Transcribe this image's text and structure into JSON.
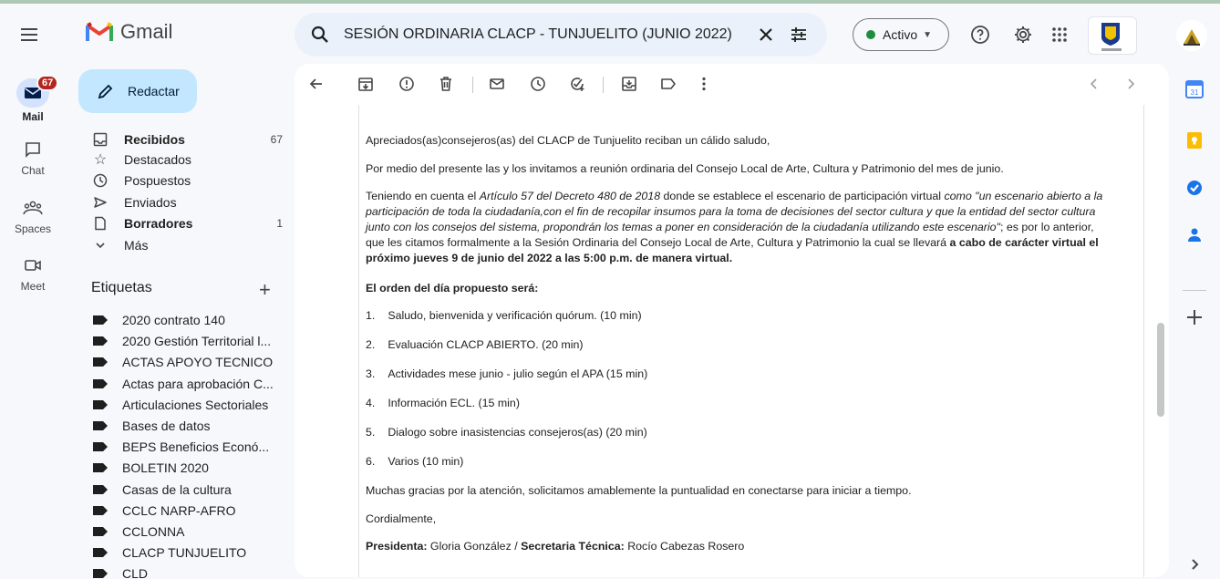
{
  "app": {
    "name": "Gmail"
  },
  "search": {
    "query": "SESIÓN ORDINARIA CLACP - TUNJUELITO (JUNIO 2022)"
  },
  "header": {
    "status_label": "Activo",
    "status_color": "#1e8e3e",
    "icons": [
      "menu-icon",
      "search-icon",
      "close-icon",
      "filter-icon",
      "help-icon",
      "settings-icon",
      "apps-icon"
    ]
  },
  "rail": {
    "mail": {
      "label": "Mail",
      "badge": "67"
    },
    "chat": {
      "label": "Chat"
    },
    "spaces": {
      "label": "Spaces"
    },
    "meet": {
      "label": "Meet"
    }
  },
  "compose": {
    "label": "Redactar"
  },
  "folders": [
    {
      "label": "Recibidos",
      "count": "67",
      "icon": "inbox-icon",
      "bold": true
    },
    {
      "label": "Destacados",
      "count": "",
      "icon": "star-icon",
      "bold": false
    },
    {
      "label": "Pospuestos",
      "count": "",
      "icon": "clock-icon",
      "bold": false
    },
    {
      "label": "Enviados",
      "count": "",
      "icon": "send-icon",
      "bold": false
    },
    {
      "label": "Borradores",
      "count": "1",
      "icon": "draft-icon",
      "bold": true
    },
    {
      "label": "Más",
      "count": "",
      "icon": "chevron-down-icon",
      "bold": false
    }
  ],
  "labels_section": {
    "title": "Etiquetas",
    "add": "+"
  },
  "labels": [
    "2020 contrato 140",
    "2020 Gestión Territorial l...",
    "ACTAS APOYO TECNICO",
    "Actas para aprobación C...",
    "Articulaciones Sectoriales",
    "Bases de datos",
    "BEPS Beneficios Econó...",
    "BOLETIN 2020",
    "Casas de la cultura",
    "CCLC NARP-AFRO",
    "CCLONNA",
    "CLACP TUNJUELITO",
    "CLD"
  ],
  "email": {
    "greeting": "Apreciados(as)consejeros(as) del CLACP de Tunjuelito reciban un cálido saludo,",
    "intro": "Por medio del presente las y los invitamos a reunión ordinaria del Consejo Local de Arte, Cultura y Patrimonio del mes de junio.",
    "p3": {
      "l1a": "Teniendo en cuenta el ",
      "l1b": "Artículo 57 del Decreto 480 de 2018",
      "l1c": "  donde se establece el escenario de participación virtual ",
      "l1d": "como \"un escenario abierto a la",
      "l2": "participación de toda la ciudadanía,con el fin de recopilar insumos para la toma de decisiones del sector cultura y que la entidad del sector cultura",
      "l3a": "junto con los consejos del sistema, propondrán los temas a poner en consideración de la ciudadanía utilizando este escenario\"",
      "l3b": ";  es por lo anterior,",
      "l4a": "que les citamos formalmente a la  Sesión Ordinaria del Consejo Local de Arte, Cultura y Patrimonio la cual se llevará ",
      "l4b": "a cabo de carácter  virtual el",
      "l5": "próximo jueves 9 de junio del 2022 a las 5:00 p.m. de manera virtual."
    },
    "agenda_title": "El orden del día propuesto será:",
    "agenda": [
      {
        "num": "1.",
        "text": "Saludo, bienvenida y verificación quórum. (10 min)"
      },
      {
        "num": "2.",
        "text": "Evaluación CLACP ABIERTO. (20 min)"
      },
      {
        "num": "3.",
        "text": "Actividades mese junio - julio según el APA (15 min)"
      },
      {
        "num": "4.",
        "text": "Información ECL. (15 min)"
      },
      {
        "num": "5.",
        "text": "Dialogo sobre inasistencias consejeros(as) (20 min)"
      },
      {
        "num": "6.",
        "text": "Varios (10 min)"
      }
    ],
    "thanks": "Muchas gracias por la atención, solicitamos amablemente la puntualidad en conectarse para iniciar a tiempo.",
    "closing": " Cordialmente,",
    "sign": {
      "president_label": "Presidenta:",
      "president_name": " Gloria González",
      "sep": "   /   ",
      "secretary_label": "Secretaria Técnica:",
      "secretary_name": " Rocío Cabezas Rosero"
    }
  },
  "right_rail": {
    "icons": [
      "calendar-icon",
      "keep-icon",
      "tasks-icon",
      "contacts-icon",
      "add-icon"
    ],
    "calendar_day": "31"
  }
}
